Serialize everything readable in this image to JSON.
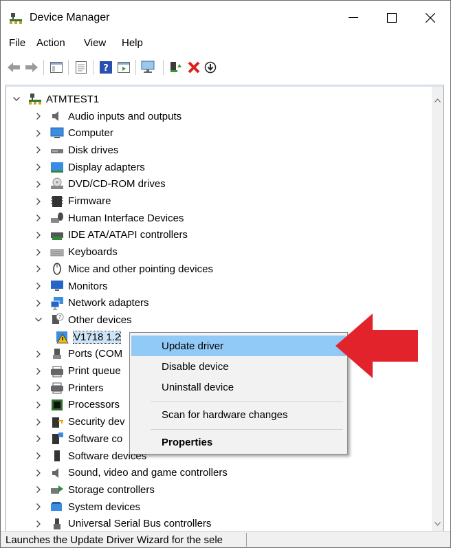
{
  "window": {
    "title": "Device Manager"
  },
  "menu": [
    "File",
    "Action",
    "View",
    "Help"
  ],
  "tree": {
    "root": "ATMTEST1",
    "items": [
      {
        "label": "Audio inputs and outputs",
        "icon": "speaker-icon"
      },
      {
        "label": "Computer",
        "icon": "computer-icon"
      },
      {
        "label": "Disk drives",
        "icon": "disk-drive-icon"
      },
      {
        "label": "Display adapters",
        "icon": "display-adapter-icon"
      },
      {
        "label": "DVD/CD-ROM drives",
        "icon": "dvd-drive-icon"
      },
      {
        "label": "Firmware",
        "icon": "firmware-icon"
      },
      {
        "label": "Human Interface Devices",
        "icon": "hid-icon"
      },
      {
        "label": "IDE ATA/ATAPI controllers",
        "icon": "ide-controller-icon"
      },
      {
        "label": "Keyboards",
        "icon": "keyboard-icon"
      },
      {
        "label": "Mice and other pointing devices",
        "icon": "mouse-icon"
      },
      {
        "label": "Monitors",
        "icon": "monitor-icon"
      },
      {
        "label": "Network adapters",
        "icon": "network-adapter-icon"
      },
      {
        "label": "Other devices",
        "icon": "other-devices-icon"
      },
      {
        "label": "V1718 1.2",
        "icon": "warning-device-icon"
      },
      {
        "label": "Ports (COM",
        "icon": "port-icon"
      },
      {
        "label": "Print queue",
        "icon": "print-queue-icon"
      },
      {
        "label": "Printers",
        "icon": "printer-icon"
      },
      {
        "label": "Processors",
        "icon": "processor-icon"
      },
      {
        "label": "Security dev",
        "icon": "security-device-icon"
      },
      {
        "label": "Software co",
        "icon": "software-component-icon"
      },
      {
        "label": "Software devices",
        "icon": "software-device-icon"
      },
      {
        "label": "Sound, video and game controllers",
        "icon": "sound-controller-icon"
      },
      {
        "label": "Storage controllers",
        "icon": "storage-controller-icon"
      },
      {
        "label": "System devices",
        "icon": "system-devices-icon"
      },
      {
        "label": "Universal Serial Bus controllers",
        "icon": "usb-icon"
      }
    ]
  },
  "context_menu": {
    "update": "Update driver",
    "disable": "Disable device",
    "uninstall": "Uninstall device",
    "scan": "Scan for hardware changes",
    "properties": "Properties"
  },
  "status": {
    "text": "Launches the Update Driver Wizard for the sele"
  },
  "colors": {
    "accent_arrow": "#e3232c",
    "highlight": "#91c9f7",
    "selection": "#cce4f7"
  }
}
